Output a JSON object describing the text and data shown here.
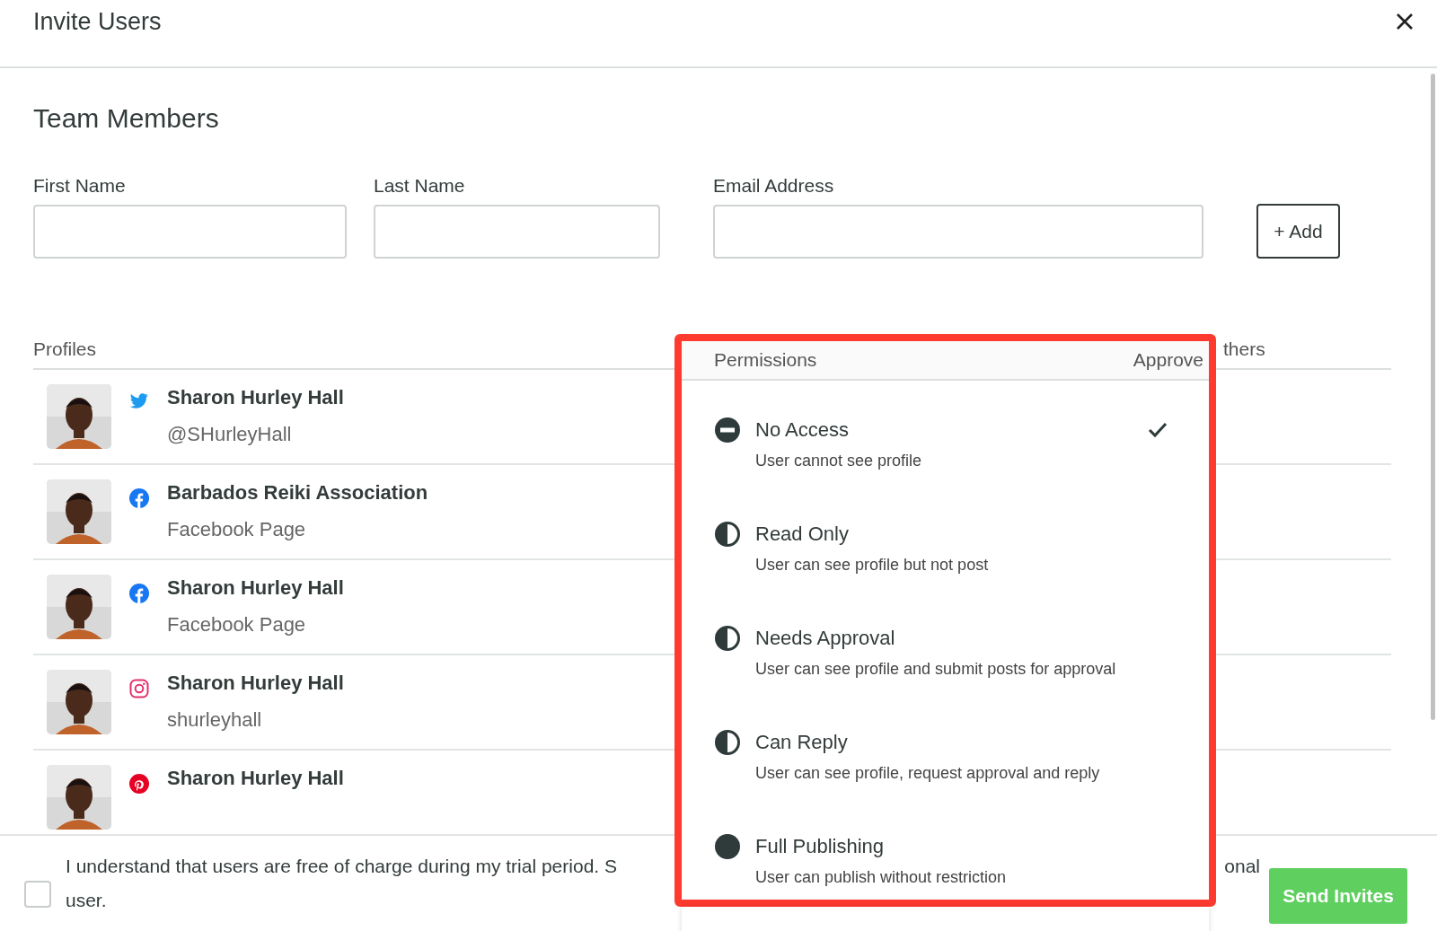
{
  "dialog": {
    "title": "Invite Users"
  },
  "section_title": "Team Members",
  "fields": [
    {
      "label": "First Name"
    },
    {
      "label": "Last Name"
    },
    {
      "label": "Email Address"
    }
  ],
  "add_button": "+ Add",
  "table": {
    "columns": [
      "Profiles",
      "thers"
    ],
    "rows": [
      {
        "name": "Sharon Hurley Hall",
        "subtitle": "@SHurleyHall",
        "kind": "twitter"
      },
      {
        "name": "Barbados Reiki Association",
        "subtitle": "Facebook Page",
        "kind": "facebook"
      },
      {
        "name": "Sharon Hurley Hall",
        "subtitle": "Facebook Page",
        "kind": "facebook"
      },
      {
        "name": "Sharon Hurley Hall",
        "subtitle": "shurleyhall",
        "kind": "instagram"
      },
      {
        "name": "Sharon Hurley Hall",
        "kind": "pinterest"
      }
    ]
  },
  "permissions_menu": {
    "header": "Permissions",
    "header_right": "Approve",
    "options": [
      {
        "title": "No Access",
        "description": "User cannot see profile",
        "kind": "none",
        "selected": true
      },
      {
        "title": "Read Only",
        "description": "User can see profile but not post",
        "kind": "half",
        "selected": false
      },
      {
        "title": "Needs Approval",
        "description": "User can see profile and submit posts for approval",
        "kind": "half",
        "selected": false
      },
      {
        "title": "Can Reply",
        "description": "User can see profile, request approval and reply",
        "kind": "half",
        "selected": false
      },
      {
        "title": "Full Publishing",
        "description": "User can publish without restriction",
        "kind": "full",
        "selected": false
      }
    ]
  },
  "footer": {
    "checked": false,
    "text_left": "I understand that users are free of charge during my trial period. S",
    "text_right": "onal",
    "text_line2": "user.",
    "send_button": "Send Invites"
  }
}
